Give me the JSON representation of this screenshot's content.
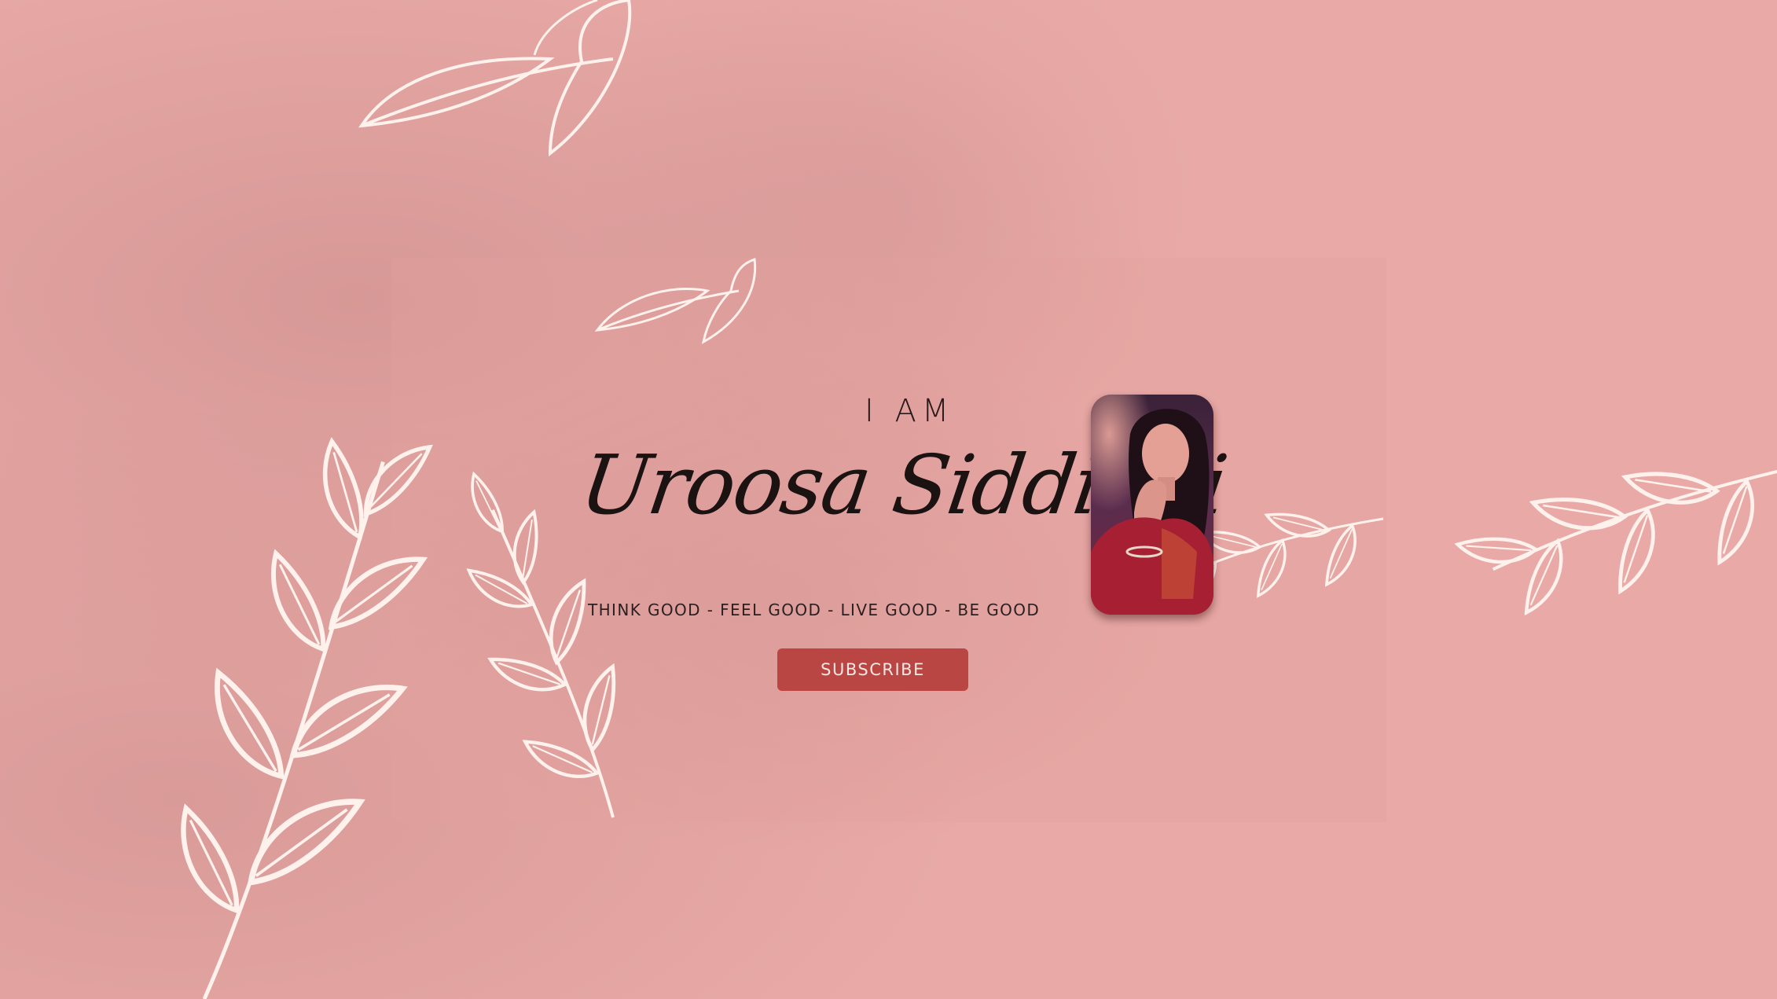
{
  "banner": {
    "intro": "I AM",
    "name": "Uroosa Siddiqui",
    "tagline": "THINK GOOD - FEEL GOOD - LIVE GOOD - BE GOOD",
    "subscribe_label": "SUBSCRIBE"
  },
  "colors": {
    "background": "#e9aaa7",
    "button": "#b94643",
    "leaf_outline": "#fff1ec",
    "text": "#1b1212"
  },
  "icons": {
    "profile_photo": "portrait-photo",
    "decoration": "leaf-branch-outline"
  }
}
